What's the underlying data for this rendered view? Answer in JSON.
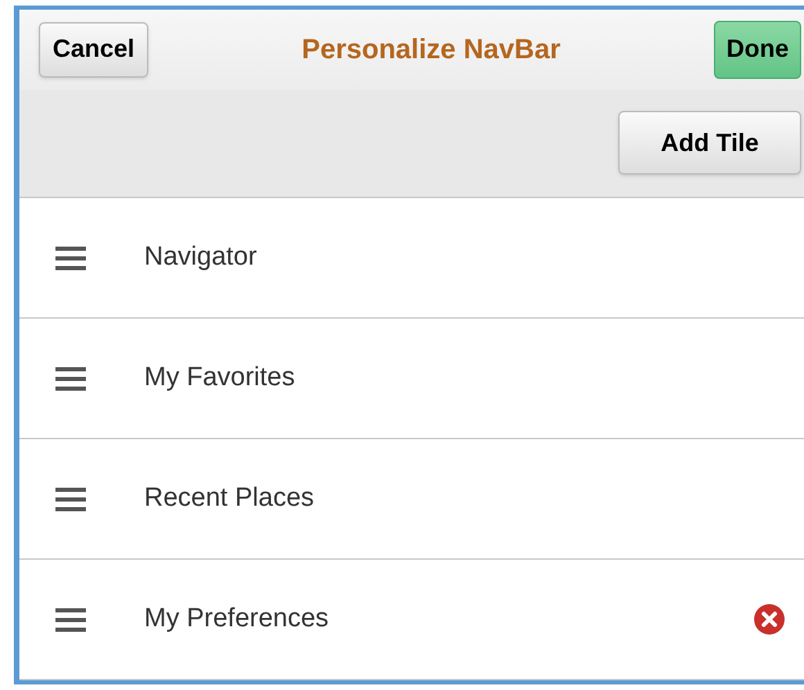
{
  "header": {
    "cancel": "Cancel",
    "title": "Personalize NavBar",
    "done": "Done"
  },
  "toolbar": {
    "add_tile": "Add Tile"
  },
  "items": [
    {
      "label": "Navigator",
      "removable": false
    },
    {
      "label": "My Favorites",
      "removable": false
    },
    {
      "label": "Recent Places",
      "removable": false
    },
    {
      "label": "My Preferences",
      "removable": true
    }
  ]
}
